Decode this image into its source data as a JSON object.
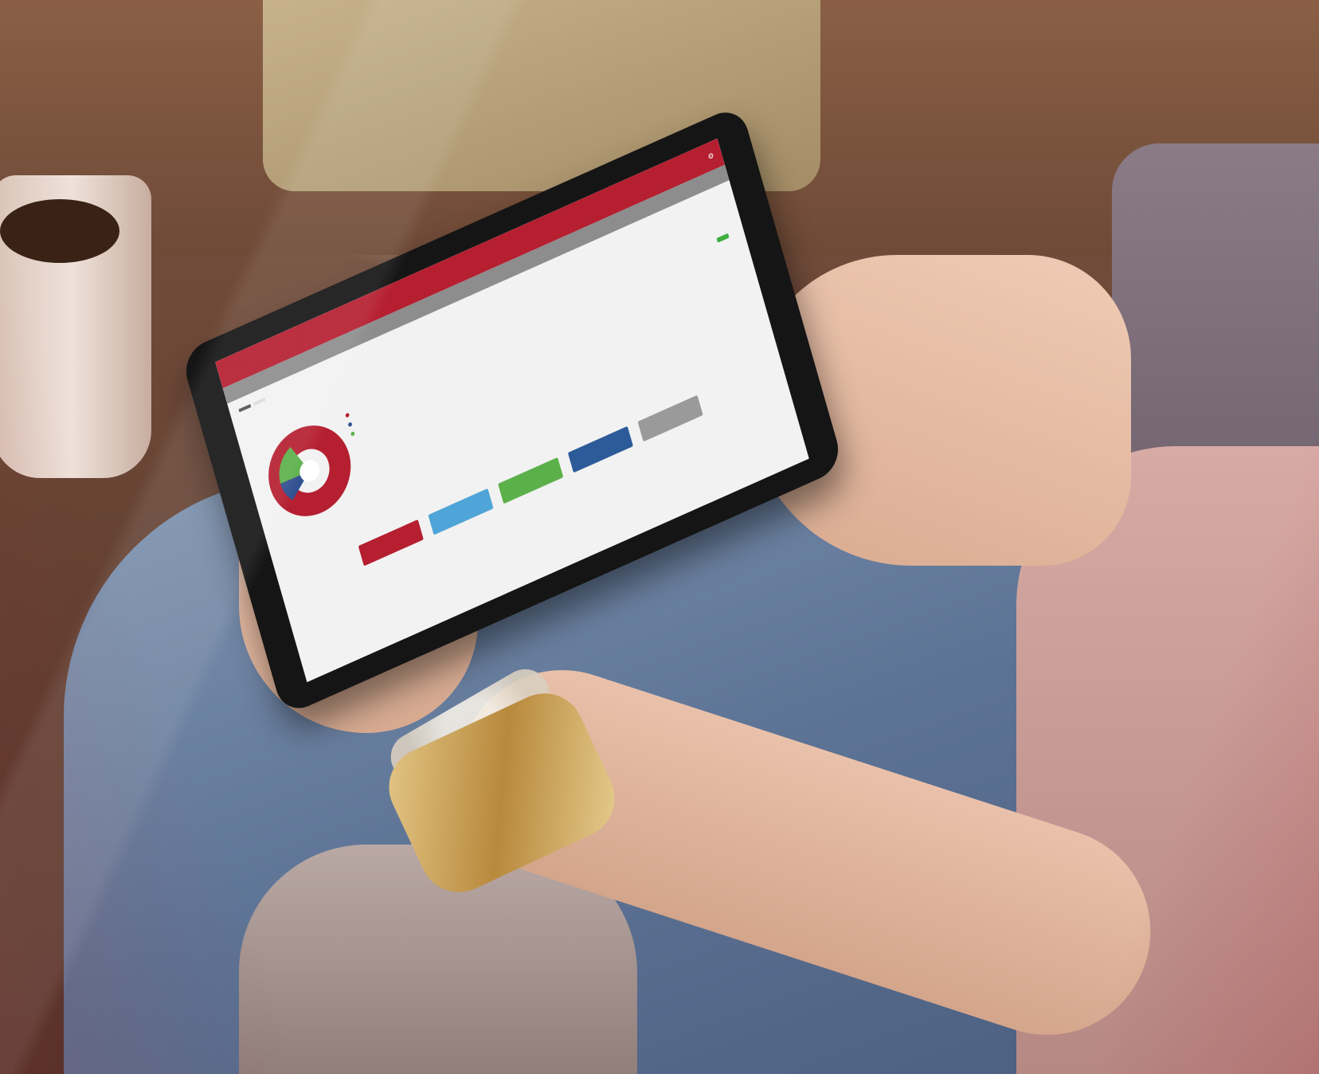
{
  "scene": {
    "description_colors": {
      "accent": "#b51f30",
      "overlay": "#a0283280"
    }
  },
  "tablet_ui": {
    "brand": "",
    "title": "",
    "tabs": [
      {
        "label": ""
      },
      {
        "label": ""
      }
    ],
    "chart_legend": [
      {
        "label": "",
        "color": "#b51f30"
      },
      {
        "label": "",
        "color": "#2f4f8f"
      },
      {
        "label": "",
        "color": "#5bb04a"
      }
    ],
    "actions": [
      {
        "label": "",
        "color": "#b51f30"
      },
      {
        "label": "",
        "color": "#4fa5d8"
      },
      {
        "label": "",
        "color": "#5bb04a"
      },
      {
        "label": "",
        "color": "#2d5b9a"
      },
      {
        "label": "",
        "color": "#9a9a9a"
      }
    ]
  }
}
